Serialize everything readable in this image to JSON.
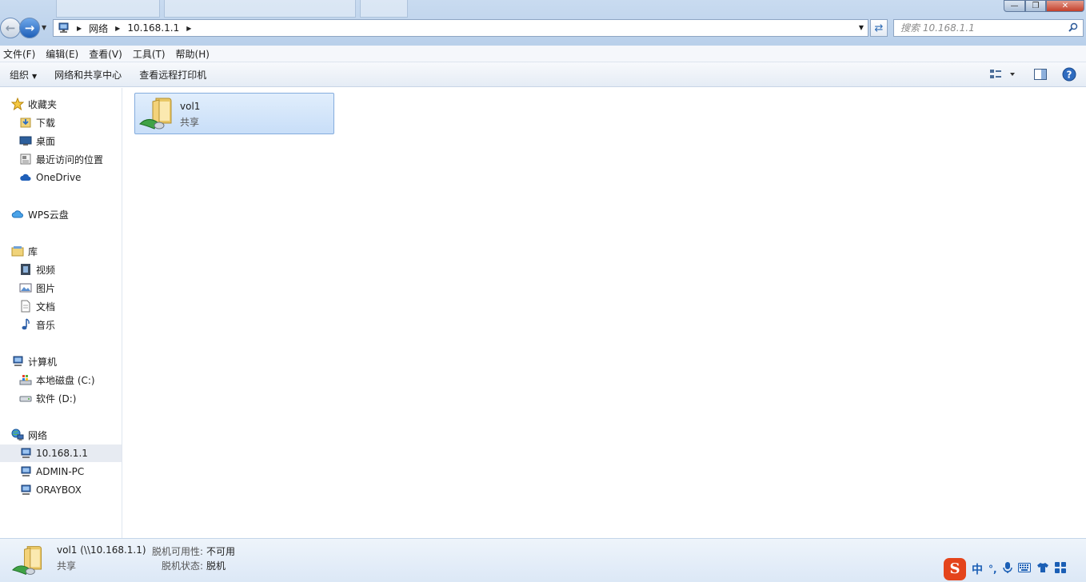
{
  "window": {
    "address": {
      "root_icon": "network-computer-icon",
      "crumbs": [
        "网络",
        "10.168.1.1"
      ]
    },
    "search_placeholder": "搜索 10.168.1.1"
  },
  "menu": [
    "文件(F)",
    "编辑(E)",
    "查看(V)",
    "工具(T)",
    "帮助(H)"
  ],
  "toolbar": {
    "organize": "组织",
    "network_center": "网络和共享中心",
    "remote_printers": "查看远程打印机"
  },
  "sidebar": {
    "favorites": {
      "label": "收藏夹",
      "items": [
        "下载",
        "桌面",
        "最近访问的位置",
        "OneDrive"
      ]
    },
    "wps": {
      "label": "WPS云盘"
    },
    "libraries": {
      "label": "库",
      "items": [
        "视频",
        "图片",
        "文档",
        "音乐"
      ]
    },
    "computer": {
      "label": "计算机",
      "items": [
        "本地磁盘 (C:)",
        "软件 (D:)"
      ]
    },
    "network": {
      "label": "网络",
      "items": [
        "10.168.1.1",
        "ADMIN-PC",
        "ORAYBOX"
      ],
      "selected": "10.168.1.1"
    }
  },
  "content": {
    "items": [
      {
        "name": "vol1",
        "type": "共享"
      }
    ]
  },
  "details": {
    "name": "vol1 (\\\\10.168.1.1)",
    "type": "共享",
    "offline_availability_label": "脱机可用性:",
    "offline_availability_value": "不可用",
    "offline_status_label": "脱机状态:",
    "offline_status_value": "脱机"
  },
  "ime": {
    "logo": "S",
    "mode": "中",
    "punct": "°,"
  },
  "colors": {
    "accent": "#1e5fb8",
    "selection": "#c8def8",
    "close": "#c4402b",
    "ime": "#e4441b"
  }
}
